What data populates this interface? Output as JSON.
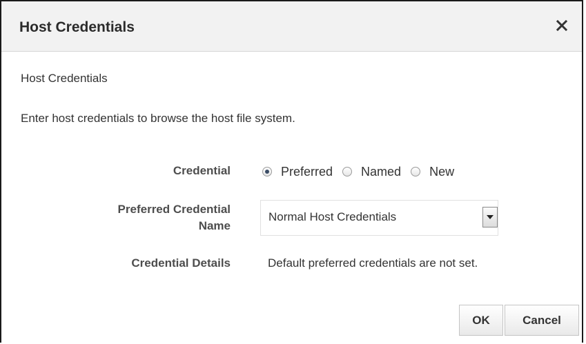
{
  "dialog": {
    "title": "Host Credentials",
    "close_icon": "close-icon",
    "subtitle": "Host Credentials",
    "instruction": "Enter host credentials to browse the host file system."
  },
  "form": {
    "credential_label": "Credential",
    "credential_options": [
      {
        "label": "Preferred",
        "selected": true
      },
      {
        "label": "Named",
        "selected": false
      },
      {
        "label": "New",
        "selected": false
      }
    ],
    "preferred_name_label_line1": "Preferred Credential",
    "preferred_name_label_line2": "Name",
    "preferred_name_value": "Normal Host Credentials",
    "details_label": "Credential Details",
    "details_value": "Default preferred credentials are not set."
  },
  "buttons": {
    "ok": "OK",
    "cancel": "Cancel"
  }
}
